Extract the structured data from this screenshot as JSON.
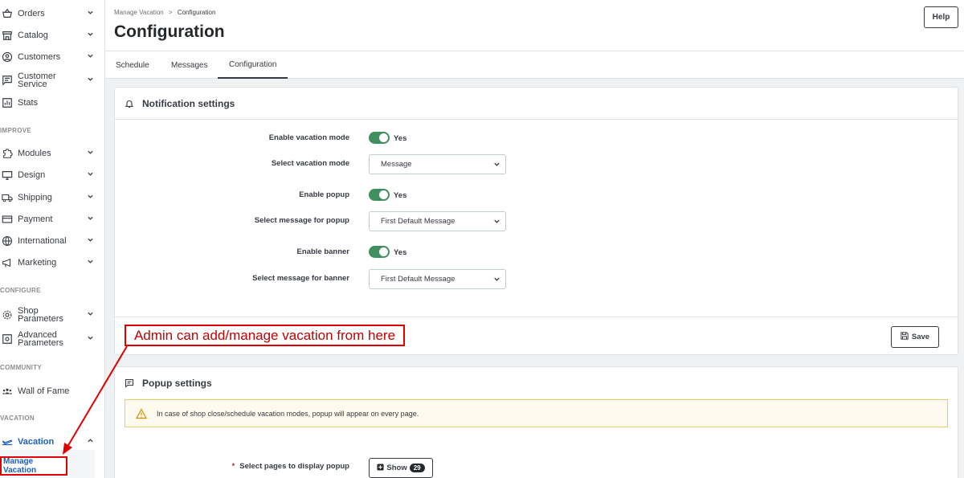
{
  "sidebar": {
    "items": [
      {
        "label": "Orders",
        "icon": "basket-icon",
        "chevron": "v"
      },
      {
        "label": "Catalog",
        "icon": "store-icon",
        "chevron": "v"
      },
      {
        "label": "Customers",
        "icon": "user-circle-icon",
        "chevron": "v"
      },
      {
        "label": "Customer Service",
        "icon": "chat-icon",
        "chevron": "v"
      },
      {
        "label": "Stats",
        "icon": "bar-chart-icon",
        "chevron": ""
      },
      {
        "label": "Modules",
        "icon": "puzzle-icon",
        "chevron": "v"
      },
      {
        "label": "Design",
        "icon": "monitor-icon",
        "chevron": "v"
      },
      {
        "label": "Shipping",
        "icon": "truck-icon",
        "chevron": "v"
      },
      {
        "label": "Payment",
        "icon": "credit-card-icon",
        "chevron": "v"
      },
      {
        "label": "International",
        "icon": "globe-icon",
        "chevron": "v"
      },
      {
        "label": "Marketing",
        "icon": "megaphone-icon",
        "chevron": "v"
      },
      {
        "label": "Shop Parameters",
        "icon": "gear-icon",
        "chevron": "v"
      },
      {
        "label": "Advanced Parameters",
        "icon": "settings-box-icon",
        "chevron": "v"
      },
      {
        "label": "Wall of Fame",
        "icon": "group-icon",
        "chevron": ""
      },
      {
        "label": "Vacation",
        "icon": "plane-icon",
        "chevron": "^"
      }
    ],
    "sections": {
      "improve": "IMPROVE",
      "configure": "CONFIGURE",
      "community": "COMMUNITY",
      "vacation": "VACATION"
    },
    "sub_item": "Manage Vacation"
  },
  "header": {
    "breadcrumb_parent": "Manage Vacation",
    "breadcrumb_sep": ">",
    "breadcrumb_current": "Configuration",
    "title": "Configuration",
    "help_label": "Help"
  },
  "tabs": [
    "Schedule",
    "Messages",
    "Configuration"
  ],
  "notification": {
    "title": "Notification settings",
    "rows": {
      "enable_vacation_label": "Enable vacation mode",
      "enable_vacation_value": "Yes",
      "select_mode_label": "Select vacation mode",
      "select_mode_value": "Message",
      "enable_popup_label": "Enable popup",
      "enable_popup_value": "Yes",
      "popup_msg_label": "Select message for popup",
      "popup_msg_value": "First Default Message",
      "enable_banner_label": "Enable banner",
      "enable_banner_value": "Yes",
      "banner_msg_label": "Select message for banner",
      "banner_msg_value": "First Default Message"
    },
    "save_label": "Save"
  },
  "popup": {
    "title": "Popup settings",
    "alert": "In case of shop close/schedule vacation modes, popup will appear on every page.",
    "pages_required": "*",
    "pages_label": "Select pages to display popup",
    "show_label": "Show",
    "show_count": "29"
  },
  "annotation": "Admin can add/manage vacation from here",
  "colors": {
    "toggle_on": "#3f8f5f",
    "annotation": "#e10000",
    "alert_bg": "#fffaee",
    "link_active": "#1d5fbf"
  }
}
